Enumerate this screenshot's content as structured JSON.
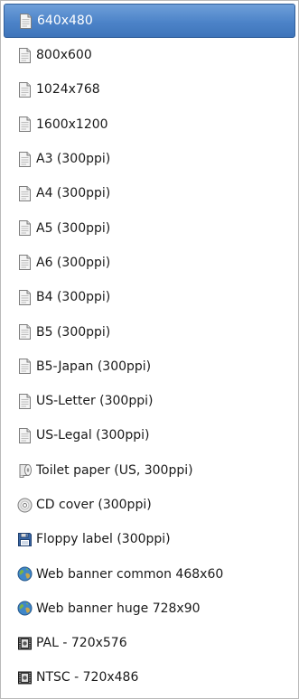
{
  "menu": {
    "items": [
      {
        "label": "640x480",
        "icon": "paper-icon"
      },
      {
        "label": "800x600",
        "icon": "paper-icon"
      },
      {
        "label": "1024x768",
        "icon": "paper-icon"
      },
      {
        "label": "1600x1200",
        "icon": "paper-icon"
      },
      {
        "label": "A3 (300ppi)",
        "icon": "paper-icon"
      },
      {
        "label": "A4 (300ppi)",
        "icon": "paper-icon"
      },
      {
        "label": "A5 (300ppi)",
        "icon": "paper-icon"
      },
      {
        "label": "A6 (300ppi)",
        "icon": "paper-icon"
      },
      {
        "label": "B4 (300ppi)",
        "icon": "paper-icon"
      },
      {
        "label": "B5 (300ppi)",
        "icon": "paper-icon"
      },
      {
        "label": "B5-Japan (300ppi)",
        "icon": "paper-icon"
      },
      {
        "label": "US-Letter (300ppi)",
        "icon": "paper-icon"
      },
      {
        "label": "US-Legal (300ppi)",
        "icon": "paper-icon"
      },
      {
        "label": "Toilet paper (US, 300ppi)",
        "icon": "toilet-paper-icon"
      },
      {
        "label": "CD cover (300ppi)",
        "icon": "cd-icon"
      },
      {
        "label": "Floppy label (300ppi)",
        "icon": "floppy-disk-icon"
      },
      {
        "label": "Web banner common 468x60",
        "icon": "globe-icon"
      },
      {
        "label": "Web banner huge 728x90",
        "icon": "globe-icon"
      },
      {
        "label": "PAL - 720x576",
        "icon": "video-icon"
      },
      {
        "label": "NTSC - 720x486",
        "icon": "video-icon"
      }
    ],
    "selected_index": 0
  },
  "colors": {
    "selection_background": "#4c83c8",
    "selection_text": "#ffffff",
    "border": "#b9b9b9"
  }
}
